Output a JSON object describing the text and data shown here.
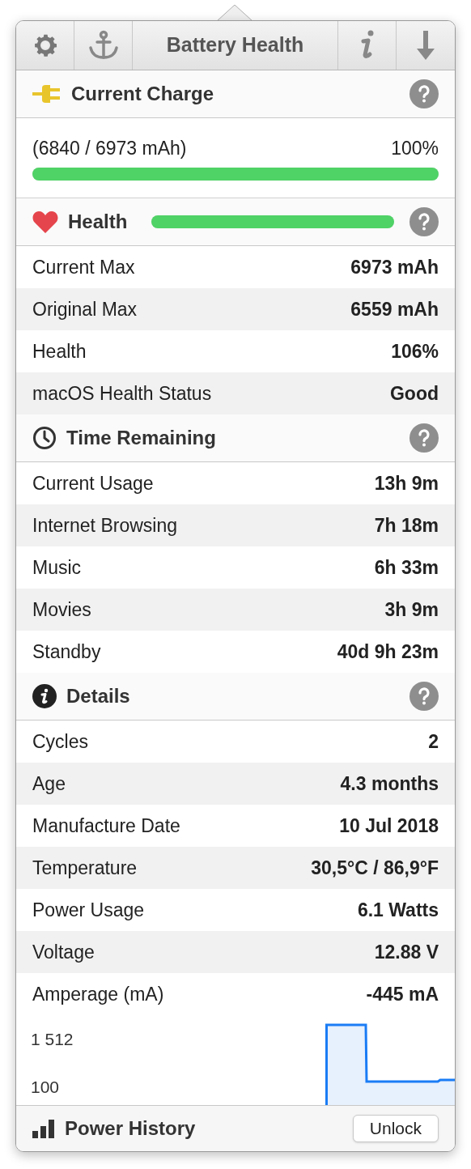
{
  "toolbar": {
    "title": "Battery Health"
  },
  "current_charge": {
    "title": "Current Charge",
    "reading": "(6840 / 6973 mAh)",
    "percent": "100%",
    "level": 1.0
  },
  "health": {
    "title": "Health",
    "level": 1.0,
    "rows": [
      {
        "label": "Current Max",
        "value": "6973 mAh"
      },
      {
        "label": "Original Max",
        "value": "6559 mAh"
      },
      {
        "label": "Health",
        "value": "106%"
      },
      {
        "label": "macOS Health Status",
        "value": "Good"
      }
    ]
  },
  "time_remaining": {
    "title": "Time Remaining",
    "rows": [
      {
        "label": "Current Usage",
        "value": "13h 9m"
      },
      {
        "label": "Internet Browsing",
        "value": "7h 18m"
      },
      {
        "label": "Music",
        "value": "6h 33m"
      },
      {
        "label": "Movies",
        "value": "3h 9m"
      },
      {
        "label": "Standby",
        "value": "40d 9h 23m"
      }
    ]
  },
  "details": {
    "title": "Details",
    "rows": [
      {
        "label": "Cycles",
        "value": "2"
      },
      {
        "label": "Age",
        "value": "4.3 months"
      },
      {
        "label": "Manufacture Date",
        "value": "10 Jul 2018"
      },
      {
        "label": "Temperature",
        "value": "30,5°C / 86,9°F"
      },
      {
        "label": "Power Usage",
        "value": "6.1 Watts"
      },
      {
        "label": "Voltage",
        "value": "12.88 V"
      },
      {
        "label": "Amperage (mA)",
        "value": "-445 mA"
      }
    ],
    "graph": {
      "axis_labels": [
        "1 512",
        "100"
      ]
    }
  },
  "footer": {
    "title": "Power History",
    "button": "Unlock"
  }
}
